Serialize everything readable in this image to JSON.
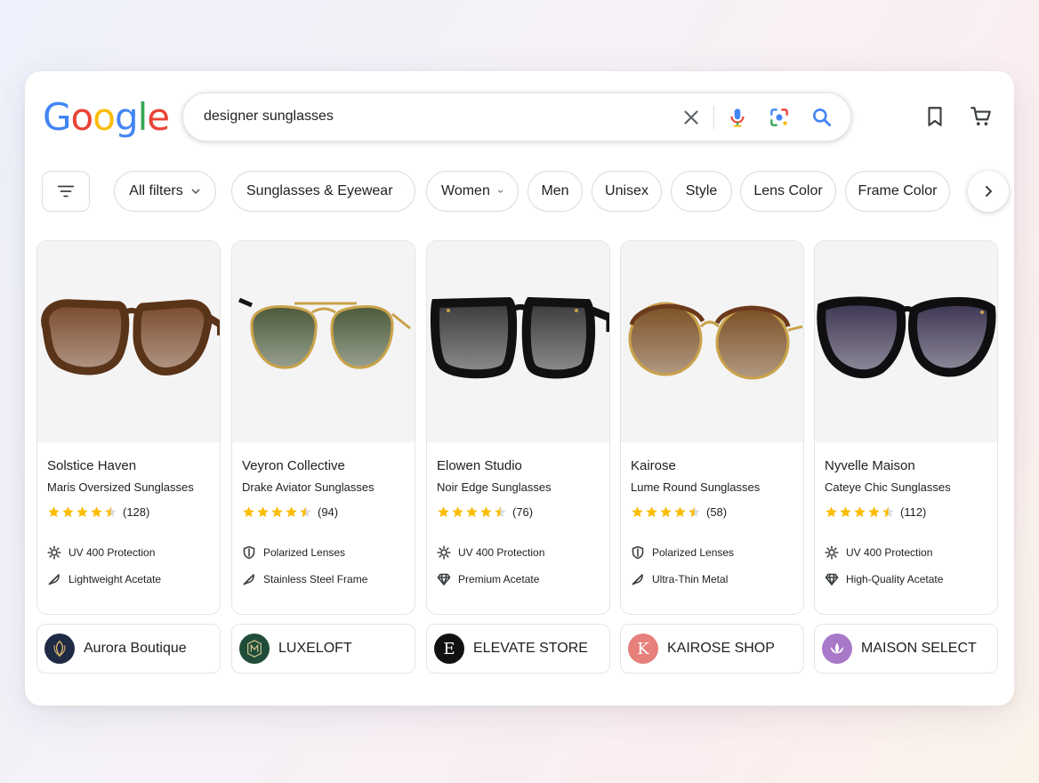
{
  "logo": {
    "letters": [
      "G",
      "o",
      "o",
      "g",
      "l",
      "e"
    ],
    "colors": [
      "#4285F4",
      "#EA4335",
      "#FBBC05",
      "#4285F4",
      "#34A853",
      "#EA4335"
    ]
  },
  "search": {
    "query": "designer sunglasses"
  },
  "header_icons": [
    "bookmark-icon",
    "cart-icon"
  ],
  "chips": [
    {
      "label": "All filters",
      "dropdown": true
    },
    {
      "label": "Sunglasses & Eyewear",
      "dropdown": true
    },
    {
      "label": "Women",
      "dropdown": true
    },
    {
      "label": "Men",
      "dropdown": false
    },
    {
      "label": "Unisex",
      "dropdown": false
    },
    {
      "label": "Style",
      "dropdown": false
    },
    {
      "label": "Lens Color",
      "dropdown": false
    },
    {
      "label": "Frame Color",
      "dropdown": false
    }
  ],
  "products": [
    {
      "brand": "Solstice Haven",
      "name": "Maris Oversized Sunglasses",
      "rating": 4.5,
      "reviews": "(128)",
      "features": [
        {
          "icon": "sun-icon",
          "text": "UV 400 Protection"
        },
        {
          "icon": "feather-icon",
          "text": "Lightweight Acetate"
        }
      ],
      "frame_color": "#5a3418",
      "lens_color": "#7a4a2c",
      "store": {
        "name": "Aurora Boutique",
        "logo_bg": "#1f2a44",
        "logo_mark": "crest-icon"
      }
    },
    {
      "brand": "Veyron Collective",
      "name": "Drake Aviator Sunglasses",
      "rating": 4.5,
      "reviews": "(94)",
      "features": [
        {
          "icon": "shield-icon",
          "text": "Polarized Lenses"
        },
        {
          "icon": "feather-icon",
          "text": "Stainless Steel Frame"
        }
      ],
      "frame_color": "#c9a24a",
      "lens_color": "#4b5a3a",
      "store": {
        "name": "LUXELOFT",
        "logo_bg": "#1f4d3a",
        "logo_mark": "monogram-icon"
      }
    },
    {
      "brand": "Elowen Studio",
      "name": "Noir Edge Sunglasses",
      "rating": 4.5,
      "reviews": "(76)",
      "features": [
        {
          "icon": "sun-icon",
          "text": "UV 400 Protection"
        },
        {
          "icon": "diamond-icon",
          "text": "Premium Acetate"
        }
      ],
      "frame_color": "#111111",
      "lens_color": "#3a3a3c",
      "store": {
        "name": "ELEVATE STORE",
        "logo_bg": "#111111",
        "logo_letter": "E"
      }
    },
    {
      "brand": "Kairose",
      "name": "Lume Round Sunglasses",
      "rating": 4.5,
      "reviews": "(58)",
      "features": [
        {
          "icon": "shield-icon",
          "text": "Polarized Lenses"
        },
        {
          "icon": "feather-icon",
          "text": "Ultra-Thin Metal"
        }
      ],
      "frame_color": "#c9a24a",
      "lens_color": "#7a4e23",
      "store": {
        "name": "KAIROSE SHOP",
        "logo_bg": "#e5807a",
        "logo_letter": "K"
      }
    },
    {
      "brand": "Nyvelle Maison",
      "name": "Cateye Chic Sunglasses",
      "rating": 4.5,
      "reviews": "(112)",
      "features": [
        {
          "icon": "sun-icon",
          "text": "UV 400 Protection"
        },
        {
          "icon": "diamond-icon",
          "text": "High-Quality Acetate"
        }
      ],
      "frame_color": "#0f0f12",
      "lens_color": "#3c3450",
      "store": {
        "name": "MAISON SELECT",
        "logo_bg": "#a979c9",
        "logo_mark": "lotus-icon"
      }
    }
  ],
  "colors": {
    "star": "#FBBC05",
    "star_empty": "#dadce0",
    "text": "#202124"
  }
}
